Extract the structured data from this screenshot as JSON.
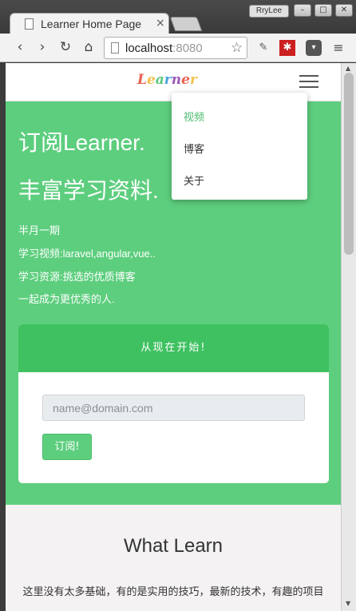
{
  "browser": {
    "tab_title": "Learner Home Page",
    "tab_close": "×",
    "profile_name": "RryLee",
    "url_host": "localhost",
    "url_port": ":8080",
    "nav": {
      "back": "‹",
      "forward": "›",
      "reload": "↻",
      "home": "⌂"
    },
    "window_controls": {
      "minimize": "–",
      "maximize": "□",
      "close": "✕"
    }
  },
  "site": {
    "logo_letters": [
      "L",
      "e",
      "a",
      "r",
      "n",
      "e",
      "r"
    ],
    "menu_items": [
      {
        "label": "视频",
        "active": true
      },
      {
        "label": "博客",
        "active": false
      },
      {
        "label": "关于",
        "active": false
      }
    ]
  },
  "hero": {
    "heading1": "订阅Learner.",
    "heading2": "丰富学习资料.",
    "lines": [
      "半月一期",
      "学习视频:laravel,angular,vue..",
      "学习资源:挑选的优质博客",
      "一起成为更优秀的人."
    ]
  },
  "signup_card": {
    "header": "从现在开始!",
    "email_placeholder": "name@domain.com",
    "button_label": "订阅!"
  },
  "section_what": {
    "title": "What Learn",
    "description": "这里没有太多基础，有的是实用的技巧，最新的技术，有趣的项目"
  },
  "colors": {
    "hero_bg": "#5dce7e",
    "card_header_bg": "#3fc161",
    "active_menu": "#4cbc6d"
  }
}
